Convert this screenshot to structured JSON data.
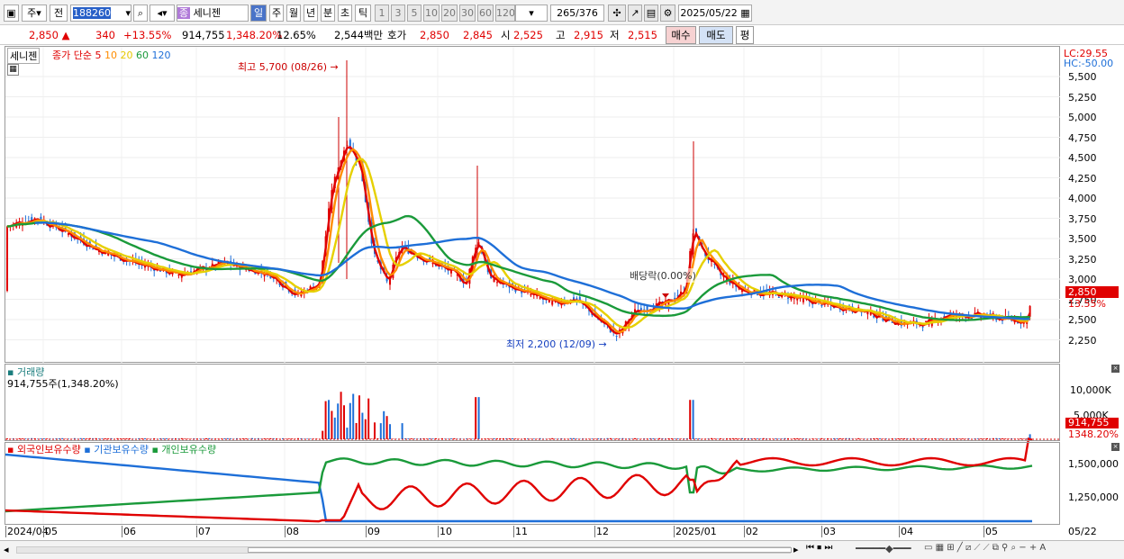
{
  "toolbar": {
    "type": "주",
    "mode": "전",
    "code": "188260",
    "name_badge": "종",
    "name": "세니젠",
    "periods": [
      "일",
      "주",
      "월",
      "년",
      "분",
      "초",
      "틱"
    ],
    "intervals": [
      "1",
      "3",
      "5",
      "10",
      "20",
      "30",
      "60",
      "120"
    ],
    "count": "265",
    "total": "376",
    "date": "2025/05/22"
  },
  "quote": {
    "price": "2,850",
    "arrow": "▲",
    "change": "340",
    "pct": "+13.55%",
    "volume": "914,755",
    "vol_pct": "1,348.20%",
    "turnover": "12.65%",
    "amount": "2,544백만",
    "hoga_label": "호가",
    "bid1": "2,850",
    "bid2": "2,845",
    "open_label": "시",
    "open": "2,525",
    "high_label": "고",
    "high": "2,915",
    "low_label": "저",
    "low": "2,515",
    "buy": "매수",
    "sell": "매도",
    "flat": "평"
  },
  "price_panel": {
    "stock_tab": "세니젠",
    "legend_type": "종가 단순",
    "ma": [
      {
        "n": "5",
        "c": "#e00000"
      },
      {
        "n": "10",
        "c": "#ff8c00"
      },
      {
        "n": "20",
        "c": "#e6c800"
      },
      {
        "n": "60",
        "c": "#1a9a3a"
      },
      {
        "n": "120",
        "c": "#1e6fd8"
      }
    ],
    "high_note": "최고 5,700 (08/26)",
    "low_note": "최저 2,200 (12/09)",
    "dividend": "배당락(0.00%)",
    "lc": "LC:29.55",
    "hc": "HC:-50.00",
    "y_ticks": [
      "5,500",
      "5,250",
      "5,000",
      "4,750",
      "4,500",
      "4,250",
      "4,000",
      "3,750",
      "3,500",
      "3,250",
      "3,000",
      "2,750",
      "2,500",
      "2,250"
    ],
    "cur_price": "2,850",
    "cur_pct": "13.55%"
  },
  "volume_panel": {
    "title": "거래량",
    "value": "914,755주(1,348.20%)",
    "ticks": [
      "10,000K",
      "5,000K"
    ],
    "cur": "914,755",
    "cur_pct": "1348.20%"
  },
  "holders_panel": {
    "series": [
      {
        "name": "외국인보유수량",
        "c": "#e00000"
      },
      {
        "name": "기관보유수량",
        "c": "#1e6fd8"
      },
      {
        "name": "개인보유수량",
        "c": "#1a9a3a"
      }
    ],
    "ticks": [
      "1,500,000",
      "1,250,000"
    ]
  },
  "x_axis": [
    "2024/04",
    "05",
    "06",
    "07",
    "08",
    "09",
    "10",
    "11",
    "12",
    "2025/01",
    "02",
    "03",
    "04",
    "05"
  ],
  "x_right": "05/22"
}
